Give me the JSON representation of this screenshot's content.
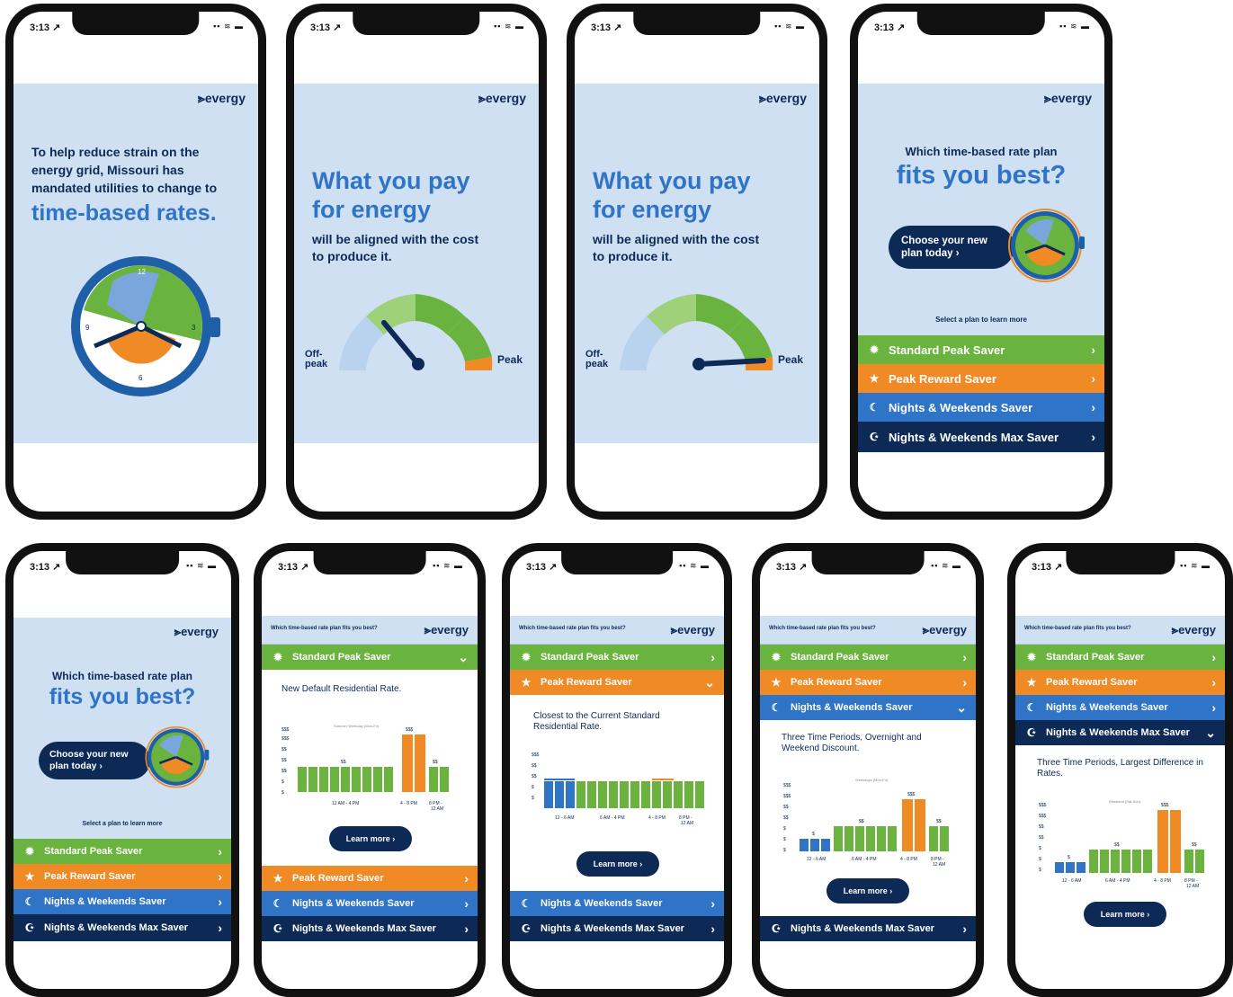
{
  "status": {
    "time": "3:13 ↗",
    "icons": "▪▪ ≋ ▬"
  },
  "brand": "⪢evergy",
  "screen1": {
    "body": "To help reduce strain on the energy grid, Missouri has mandated utilities to change to",
    "big": "time-based rates.",
    "clock": {
      "n12": "12",
      "n3": "3",
      "n6": "6",
      "n9": "9"
    }
  },
  "screen2": {
    "big": "What you pay for energy",
    "body": "will be aligned with the cost to produce it.",
    "offpeak": "Off-peak",
    "peak": "Peak"
  },
  "screen4": {
    "question": "Which time-based rate plan",
    "big": "fits you best?",
    "cta": "Choose your new plan today ›",
    "select": "Select a plan to learn more"
  },
  "header_q": "Which time-based rate plan fits you best?",
  "plans": [
    {
      "label": "Standard Peak Saver",
      "icon": "sun-icon",
      "color": "#6ab33e"
    },
    {
      "label": "Peak Reward Saver",
      "icon": "star-icon",
      "color": "#f08a24"
    },
    {
      "label": "Nights & Weekends Saver",
      "icon": "moon-icon",
      "color": "#2f74c6"
    },
    {
      "label": "Nights & Weekends Max Saver",
      "icon": "moon-star-icon",
      "color": "#0d2a56"
    }
  ],
  "chevron": "›",
  "learn_more": "Learn more ›",
  "details": {
    "standard": "New Default Residential Rate.",
    "reward": "Closest to the Current Standard Residential Rate.",
    "nights": "Three Time Periods, Overnight and Weekend Discount.",
    "max": "Three Time Periods, Largest Difference in Rates."
  },
  "chart_labels": {
    "y": [
      "$$$",
      "$$$",
      "$$",
      "$$",
      "$"
    ],
    "x1": "12 AM - 4 PM",
    "x2": "4 - 8 PM",
    "x3": "8 PM - 12 AM",
    "x_a": "12 - 6 AM",
    "x_b": "6 AM - 4 PM",
    "weekday": "Summer Weekday (Mon-Fri)",
    "weekday2": "Weekdays (Mon-Fri)",
    "weekend": "Weekend (Sat-Sun)",
    "bar_s": "$$",
    "bar_p": "$$$",
    "bar_e": "$$",
    "bar_low": "$"
  }
}
